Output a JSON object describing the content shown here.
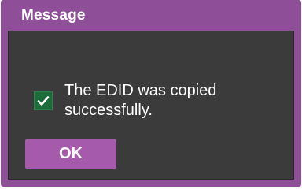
{
  "dialog": {
    "title": "Message",
    "message": "The EDID was copied successfully.",
    "ok_label": "OK",
    "icon": "checkmark-icon"
  },
  "colors": {
    "frame": "#8e4f98",
    "body": "#3b3b3b",
    "button": "#a55aac",
    "success": "#1c6b3a"
  }
}
